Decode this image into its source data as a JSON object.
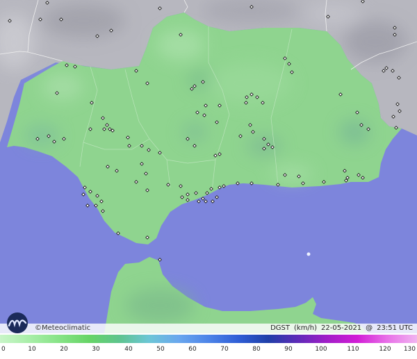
{
  "brand": {
    "copyright_symbol": "©",
    "name": "Meteoclimatic"
  },
  "caption": {
    "variable": "DGST",
    "unit": "(km/h)",
    "date": "22-05-2021",
    "at": "@",
    "time": "23:51 UTC"
  },
  "legend": {
    "ticks": [
      "0",
      "10",
      "20",
      "30",
      "40",
      "50",
      "60",
      "70",
      "80",
      "90",
      "100",
      "110",
      "120",
      "130"
    ],
    "range": [
      0,
      130
    ],
    "colors": [
      "#c8f5c8",
      "#a8eea8",
      "#86e386",
      "#66d466",
      "#5ec48e",
      "#6cc6d6",
      "#6aa7ee",
      "#4d84e8",
      "#2f5ed6",
      "#1f3fa8",
      "#5e2bb8",
      "#a21ec8",
      "#d21ed6",
      "#e870e8",
      "#f0b4f0"
    ]
  },
  "colors": {
    "sea": "#7d85dc",
    "land_green": "#8fd48f",
    "terrain_grey": "#b9b9c1",
    "border": "#f2f2f2",
    "station": "#1a1a1a"
  }
}
